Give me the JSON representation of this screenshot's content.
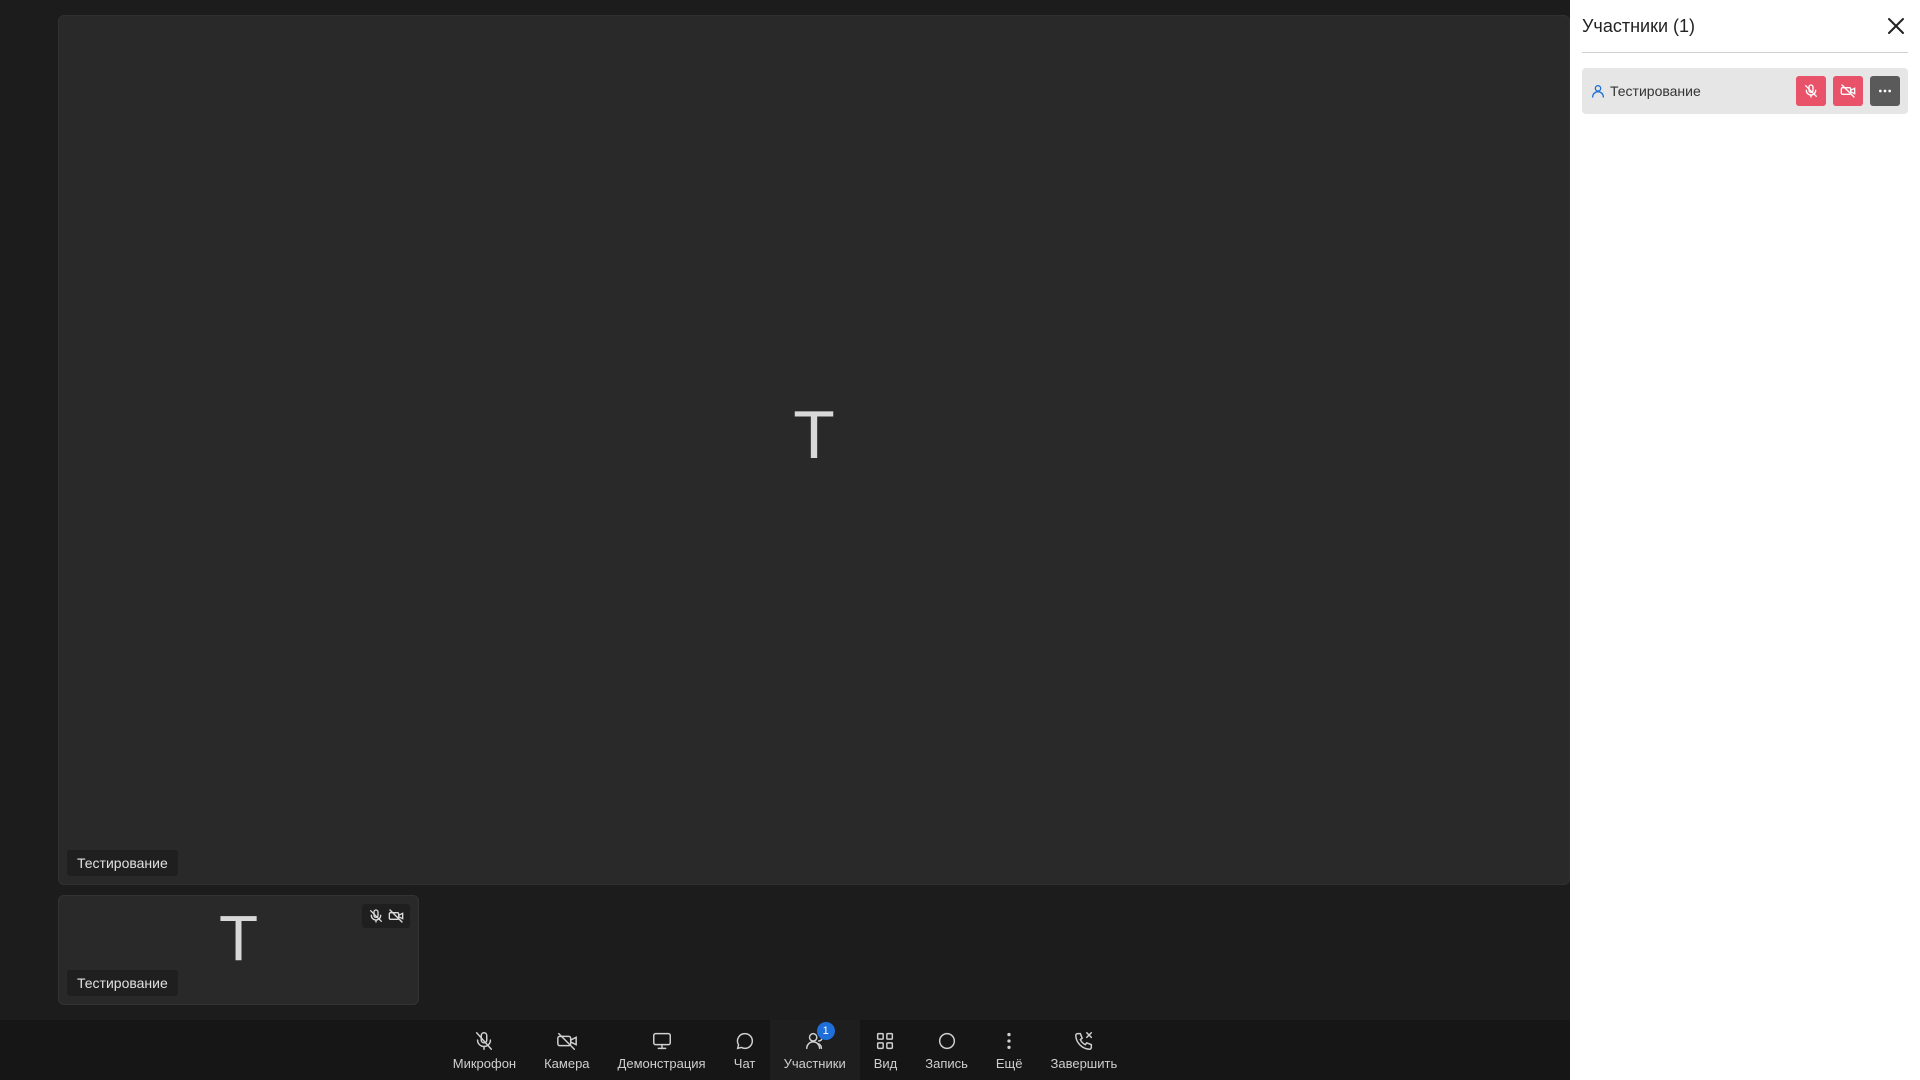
{
  "main_tile": {
    "avatar_letter": "T",
    "name": "Тестирование"
  },
  "thumbnail": {
    "avatar_letter": "T",
    "name": "Тестирование",
    "status_icons": [
      "mic-off-icon",
      "camera-off-icon"
    ]
  },
  "toolbar": {
    "buttons": [
      {
        "label": "Микрофон",
        "icon": "mic-off-icon"
      },
      {
        "label": "Камера",
        "icon": "camera-off-icon"
      },
      {
        "label": "Демонстрация",
        "icon": "monitor-icon"
      },
      {
        "label": "Чат",
        "icon": "chat-icon"
      },
      {
        "label": "Участники",
        "icon": "participants-icon",
        "badge": "1",
        "active": true
      },
      {
        "label": "Вид",
        "icon": "grid-icon"
      },
      {
        "label": "Запись",
        "icon": "record-icon"
      },
      {
        "label": "Ещё",
        "icon": "more-vertical-icon"
      },
      {
        "label": "Завершить",
        "icon": "end-call-icon"
      }
    ]
  },
  "panel": {
    "title": "Участники (1)",
    "participants": [
      {
        "name": "Тестирование",
        "icon": "user-icon",
        "actions": [
          "mic-off-icon",
          "camera-off-icon",
          "more-horizontal-icon"
        ]
      }
    ]
  },
  "colors": {
    "background": "#1c1c1c",
    "tile": "#292929",
    "toolbar": "#161616",
    "badge": "#1e6fd9",
    "muted_red": "#e8536a",
    "panel": "#ffffff"
  }
}
